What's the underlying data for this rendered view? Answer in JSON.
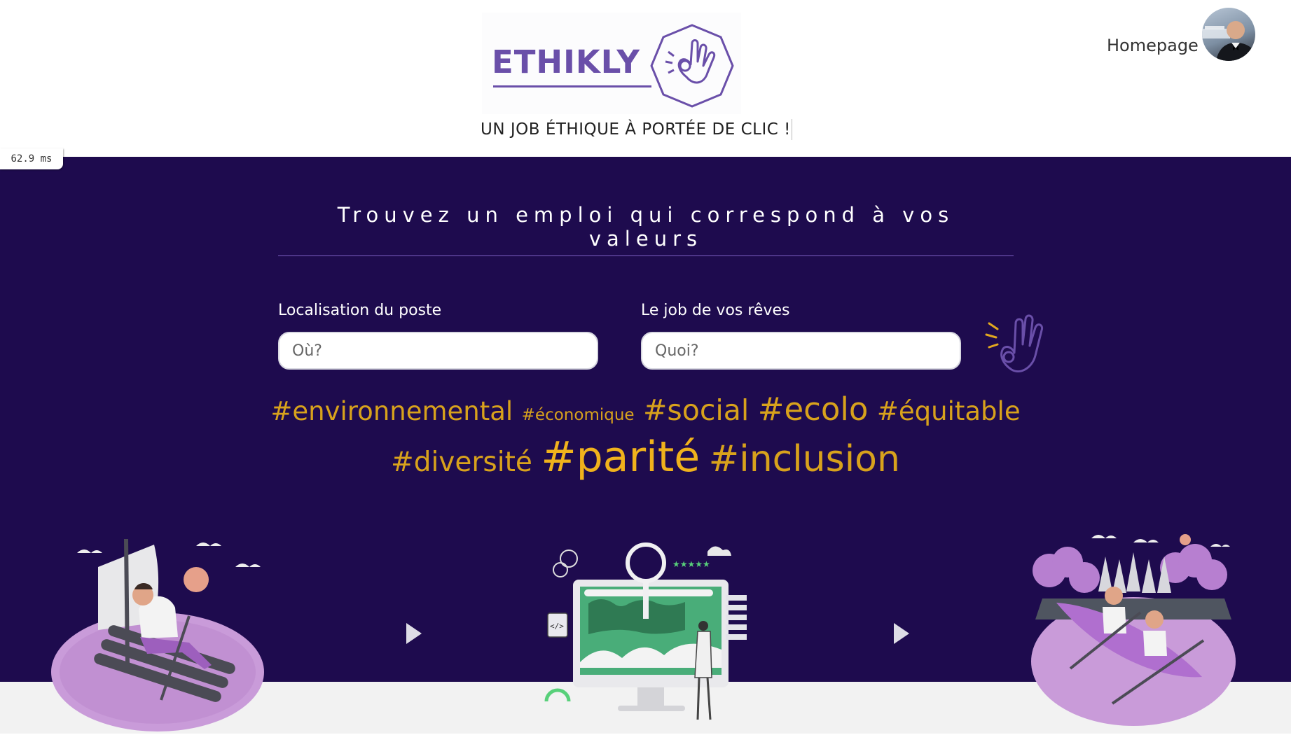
{
  "header": {
    "logo_text": "ETHIKLY",
    "tagline": "UN JOB ÉTHIQUE À PORTÉE DE CLIC !",
    "nav_home": "Homepage",
    "timing_badge": "62.9 ms"
  },
  "hero": {
    "title": "Trouvez un emploi qui correspond à vos valeurs",
    "location_label": "Localisation du poste",
    "location_placeholder": "Où?",
    "job_label": "Le job de vos rêves",
    "job_placeholder": "Quoi?"
  },
  "tags_row1": [
    "#environnemental",
    "#économique",
    "#social",
    "#ecolo",
    "#équitable"
  ],
  "tags_row2": [
    "#diversité",
    "#parité",
    "#inclusion"
  ],
  "colors": {
    "hero_bg": "#1e0b4e",
    "brand_purple": "#6a4fa9",
    "tag_gold": "#d8a21c",
    "accent_violet": "#7c5fc2"
  },
  "icons": [
    "ok-hand-icon",
    "play-arrow-icon",
    "avatar"
  ]
}
